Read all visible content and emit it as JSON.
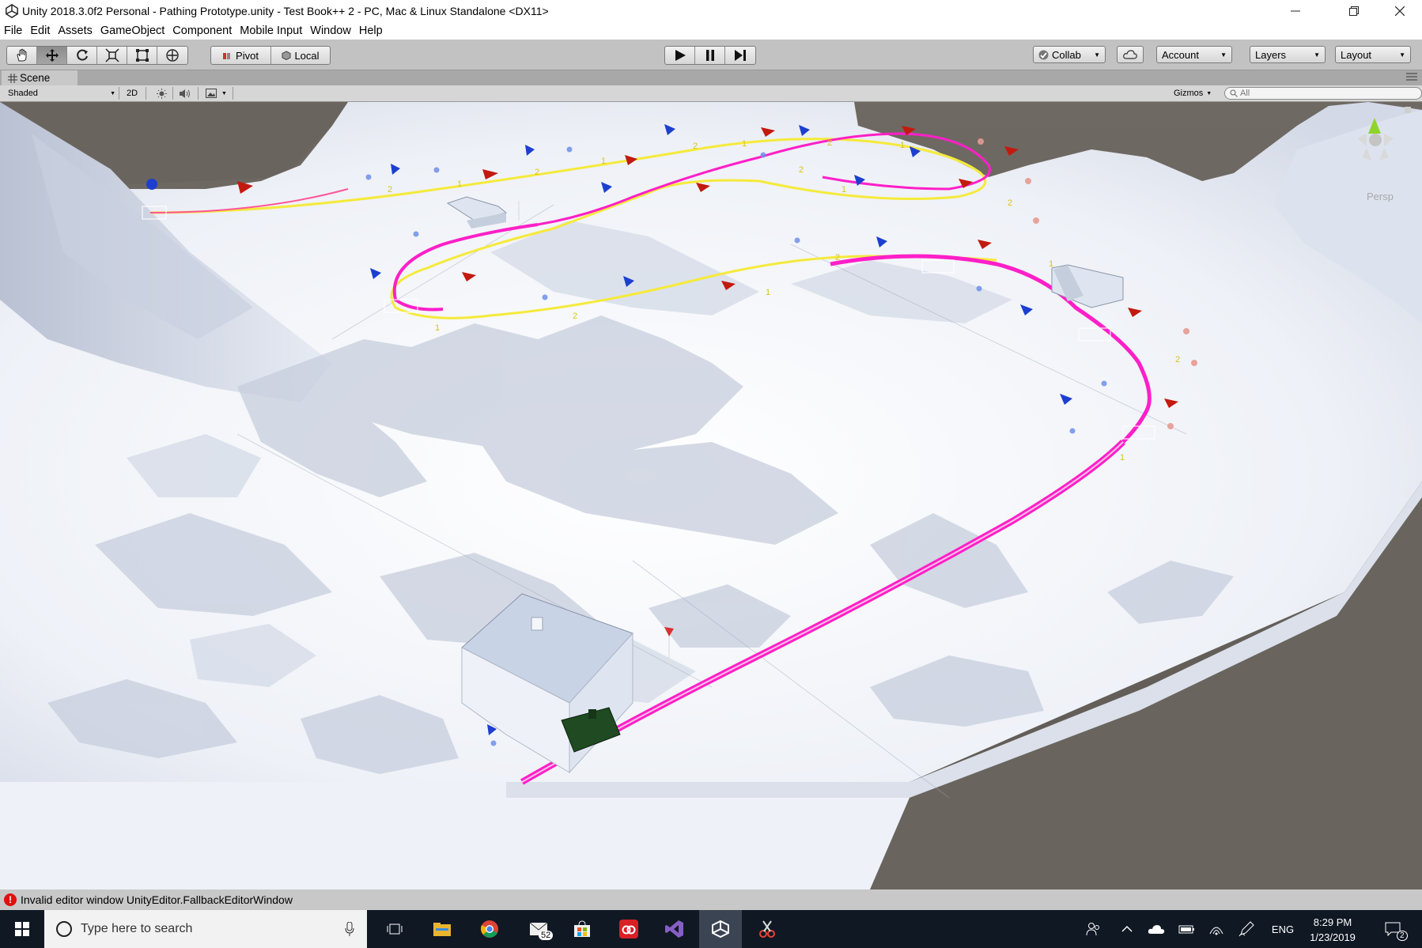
{
  "window": {
    "title": "Unity 2018.3.0f2 Personal - Pathing Prototype.unity - Test Book++ 2 - PC, Mac & Linux Standalone <DX11>",
    "minimize_icon": "minimize-icon",
    "maximize_icon": "restore-icon",
    "close_icon": "close-icon"
  },
  "menu": [
    "File",
    "Edit",
    "Assets",
    "GameObject",
    "Component",
    "Mobile Input",
    "Window",
    "Help"
  ],
  "toolbar": {
    "transform_tools": [
      "hand-tool",
      "move-tool",
      "rotate-tool",
      "scale-tool",
      "rect-tool",
      "transform-tool"
    ],
    "active_tool": "move-tool",
    "pivot_label": "Pivot",
    "local_label": "Local",
    "play_controls": [
      "play-icon",
      "pause-icon",
      "step-icon"
    ],
    "collab_label": "Collab",
    "account_label": "Account",
    "layers_label": "Layers",
    "layout_label": "Layout"
  },
  "scene_tab": {
    "label": "Scene"
  },
  "scene_toolbar": {
    "draw_mode": "Shaded",
    "mode_2d": "2D",
    "gizmos_label": "Gizmos",
    "search_placeholder": "All"
  },
  "viewport": {
    "projection_label": "Persp",
    "colors": {
      "terrain": "#f2f5fa",
      "background": "#6a645e",
      "track": "#ff1fc8",
      "path": "#f5ea3a",
      "marker_red": "#c21a0f",
      "marker_blue": "#1c3fd0",
      "gizmo_y": "#8fd42c"
    },
    "waypoint_labels": [
      "2",
      "1",
      "2",
      "1",
      "2",
      "1",
      "2",
      "1",
      "2",
      "1",
      "2",
      "1",
      "2",
      "1",
      "2",
      "1",
      "2",
      "1"
    ]
  },
  "status": {
    "error_icon": "error-icon",
    "message": "Invalid editor window UnityEditor.FallbackEditorWindow"
  },
  "taskbar": {
    "search_placeholder": "Type here to search",
    "mail_badge": "52",
    "apps": [
      "windows-start-icon",
      "task-view-icon",
      "file-explorer-icon",
      "chrome-icon",
      "mail-icon",
      "store-icon",
      "creative-cloud-icon",
      "visual-studio-icon",
      "unity-icon",
      "snipping-tool-icon"
    ],
    "tray": [
      "people-icon",
      "chevron-up-icon",
      "onedrive-icon",
      "battery-icon",
      "wifi-icon",
      "pen-icon"
    ],
    "language": "ENG",
    "time": "8:29 PM",
    "date": "1/23/2019",
    "notification_count": "2"
  }
}
